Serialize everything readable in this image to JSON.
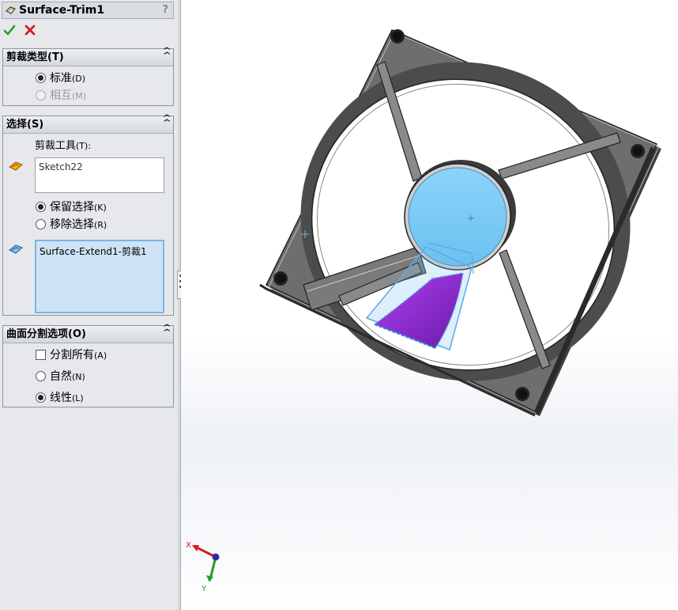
{
  "property_manager": {
    "title": "Surface-Trim1",
    "help_glyph": "?",
    "trim_type": {
      "header": "剪裁类型(T)",
      "options": [
        {
          "label": "标准",
          "shortcut": "(D)",
          "selected": true,
          "disabled": false
        },
        {
          "label": "相互",
          "shortcut": "(M)",
          "selected": false,
          "disabled": true
        }
      ]
    },
    "selections": {
      "header": "选择(S)",
      "trim_tool_label": "剪裁工具",
      "trim_tool_shortcut": "(T):",
      "trim_tool_value": "Sketch22",
      "options": [
        {
          "label": "保留选择",
          "shortcut": "(K)",
          "selected": true
        },
        {
          "label": "移除选择",
          "shortcut": "(R)",
          "selected": false
        }
      ],
      "pieces_value": "Surface-Extend1-剪裁1"
    },
    "surface_split": {
      "header": "曲面分割选项(O)",
      "split_all": {
        "label": "分割所有",
        "shortcut": "(A)",
        "checked": false
      },
      "options": [
        {
          "label": "自然",
          "shortcut": "(N)",
          "selected": false
        },
        {
          "label": "线性",
          "shortcut": "(L)",
          "selected": true
        }
      ]
    }
  },
  "triad": {
    "x_label": "X",
    "y_label": "Y"
  },
  "colors": {
    "ok_green": "#2e9a2e",
    "cancel_red": "#d22020",
    "hub_blue": "#7ccaf5",
    "trim_purple": "#8a2be2",
    "frame_gray": "#5a5a5a"
  }
}
